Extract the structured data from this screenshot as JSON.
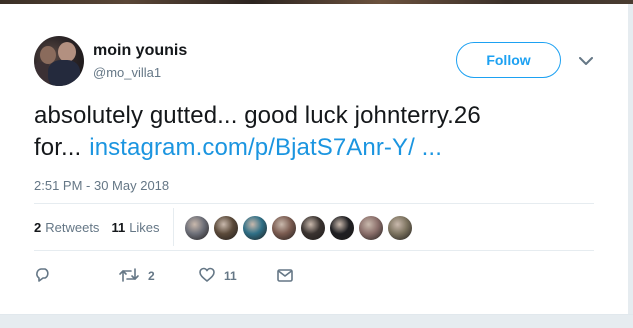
{
  "user": {
    "display_name": "moin younis",
    "handle": "@mo_villa1"
  },
  "follow_label": "Follow",
  "tweet": {
    "text_line1": "absolutely gutted... good luck johnterry.26",
    "text_line2_prefix": "for...",
    "link_text": "instagram.com/p/BjatS7Anr-Y/  ..."
  },
  "timestamp": "2:51 PM - 30 May 2018",
  "stats": {
    "retweets_count": "2",
    "retweets_label": "Retweets",
    "likes_count": "11",
    "likes_label": "Likes"
  },
  "liker_avatar_colors": [
    "#6d6f78",
    "#5b4a3a",
    "#2f6f86",
    "#7a5b50",
    "#3a3330",
    "#1f1f22",
    "#8a6e6a",
    "#7c735f"
  ],
  "actions": {
    "reply_count": "",
    "retweet_count": "2",
    "like_count": "11"
  },
  "colors": {
    "accent": "#1da1f2",
    "link": "#1b95e0",
    "muted": "#657786",
    "text": "#14171a"
  }
}
